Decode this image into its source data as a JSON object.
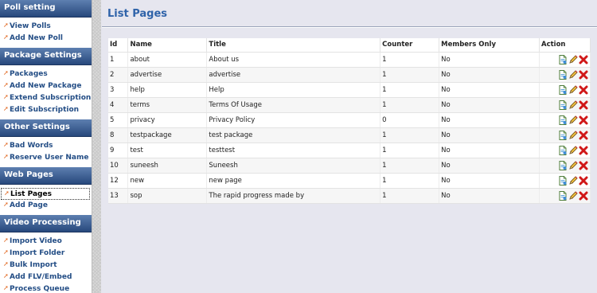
{
  "sidebar": {
    "sections": [
      {
        "title": "Poll setting",
        "items": [
          "View Polls",
          "Add New Poll"
        ]
      },
      {
        "title": "Package Settings",
        "items": [
          "Packages",
          "Add New Package",
          "Extend Subscription",
          "Edit Subscription"
        ]
      },
      {
        "title": "Other Settings",
        "items": [
          "Bad Words",
          "Reserve User Name"
        ]
      },
      {
        "title": "Web Pages",
        "items": [
          "List Pages",
          "Add Page"
        ]
      },
      {
        "title": "Video Processing",
        "items": [
          "Import Video",
          "Import Folder",
          "Bulk Import",
          "Add FLV/Embed",
          "Process Queue"
        ]
      }
    ]
  },
  "main": {
    "title": "List Pages",
    "columns": [
      "Id",
      "Name",
      "Title",
      "Counter",
      "Members Only",
      "Action"
    ],
    "rows": [
      [
        "1",
        "about",
        "About us",
        "1",
        "No"
      ],
      [
        "2",
        "advertise",
        "advertise",
        "1",
        "No"
      ],
      [
        "3",
        "help",
        "Help",
        "1",
        "No"
      ],
      [
        "4",
        "terms",
        "Terms Of Usage",
        "1",
        "No"
      ],
      [
        "5",
        "privacy",
        "Privacy Policy",
        "0",
        "No"
      ],
      [
        "8",
        "testpackage",
        "test package",
        "1",
        "No"
      ],
      [
        "9",
        "test",
        "testtest",
        "1",
        "No"
      ],
      [
        "10",
        "suneesh",
        "Suneesh",
        "1",
        "No"
      ],
      [
        "12",
        "new",
        "new page",
        "1",
        "No"
      ],
      [
        "13",
        "sop",
        "The rapid progress made by",
        "1",
        "No"
      ]
    ]
  },
  "icons": {
    "view": "page-view-icon",
    "edit": "pencil-edit-icon",
    "delete": "red-x-delete-icon"
  },
  "colors": {
    "accent": "#2f63a9",
    "sidebar_header": "#3a5b8f",
    "link": "#234d85",
    "bullet": "#e0641c",
    "delete": "#d01818"
  }
}
